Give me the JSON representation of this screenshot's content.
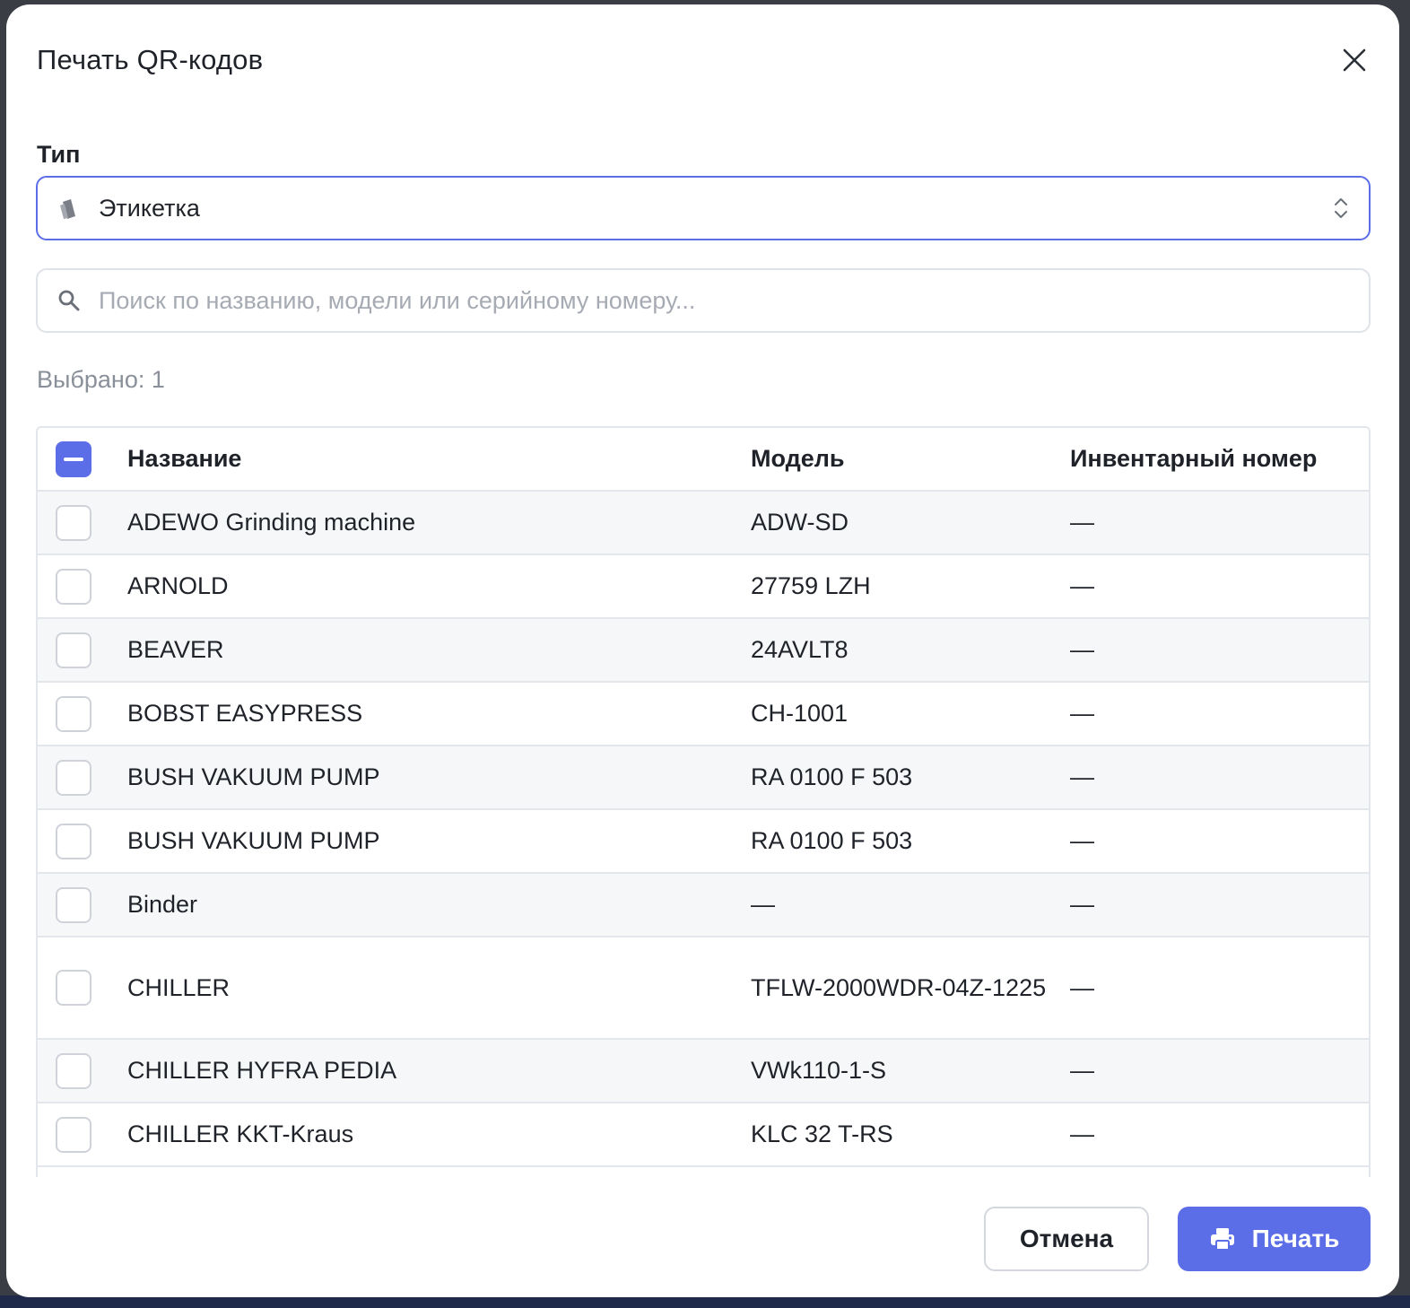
{
  "dialog": {
    "title": "Печать QR-кодов",
    "close_icon": "close-icon"
  },
  "type_field": {
    "label": "Тип",
    "value": "Этикетка",
    "icon": "tag-icon"
  },
  "search": {
    "placeholder": "Поиск по названию, модели или серийному номеру...",
    "value": ""
  },
  "selected_text": "Выбрано: 1",
  "table": {
    "columns": [
      "Название",
      "Модель",
      "Инвентарный номер"
    ],
    "header_checkbox_state": "indeterminate",
    "rows": [
      {
        "name": "ADEWO Grinding machine",
        "model": "ADW-SD",
        "inventory": "—",
        "checked": false
      },
      {
        "name": "ARNOLD",
        "model": "27759 LZH",
        "inventory": "—",
        "checked": false
      },
      {
        "name": "BEAVER",
        "model": "24AVLT8",
        "inventory": "—",
        "checked": false
      },
      {
        "name": "BOBST EASYPRESS",
        "model": "CH-1001",
        "inventory": "—",
        "checked": false
      },
      {
        "name": "BUSH VAKUUM PUMP",
        "model": "RA 0100 F 503",
        "inventory": "—",
        "checked": false
      },
      {
        "name": "BUSH VAKUUM PUMP",
        "model": "RA 0100 F 503",
        "inventory": "—",
        "checked": false
      },
      {
        "name": "Binder",
        "model": "—",
        "inventory": "—",
        "checked": false
      },
      {
        "name": "CHILLER",
        "model": "TFLW-2000WDR-04Z-1225",
        "inventory": "—",
        "checked": false
      },
      {
        "name": "CHILLER HYFRA PEDIA",
        "model": "VWk110-1-S",
        "inventory": "—",
        "checked": false
      },
      {
        "name": "CHILLER KKT-Kraus",
        "model": "KLC 32 T-RS",
        "inventory": "—",
        "checked": false
      }
    ]
  },
  "footer": {
    "cancel_label": "Отмена",
    "print_label": "Печать",
    "print_icon": "printer-icon"
  },
  "colors": {
    "accent": "#5b6ee8",
    "border": "#e3e6ea",
    "muted_text": "#8a9099"
  }
}
